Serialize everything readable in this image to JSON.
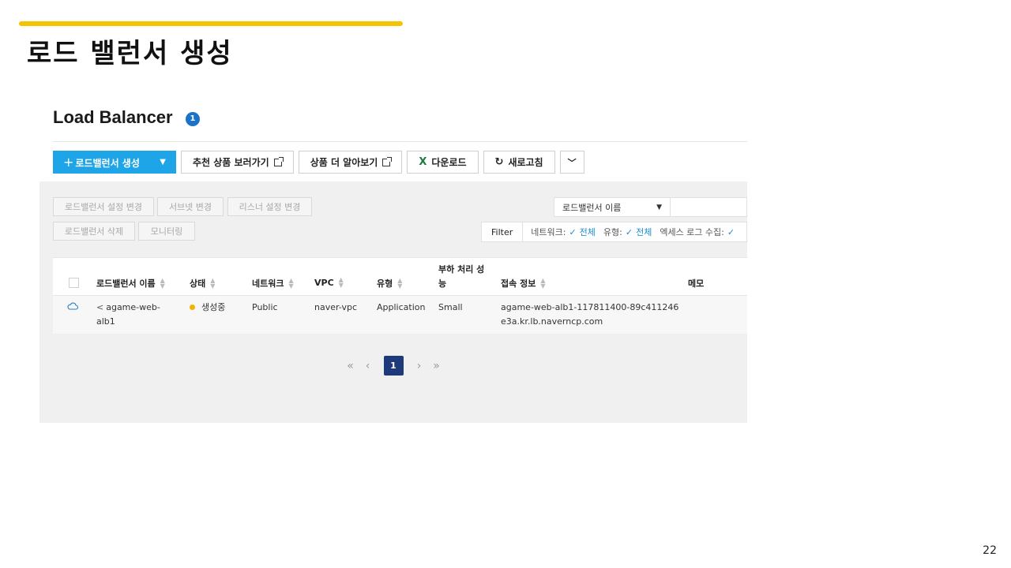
{
  "slide": {
    "title": "로드 밸런서 생성",
    "page_number": "22",
    "accent_color": "#f5c400"
  },
  "console": {
    "title": "Load Balancer",
    "count": "1",
    "toolbar": {
      "create_label": "로드밸런서 생성",
      "recommend_label": "추천 상품 보러가기",
      "learn_more_label": "상품 더 알아보기",
      "download_label": "다운로드",
      "refresh_label": "새로고침",
      "primary_color": "#1ea5e8"
    },
    "actions": {
      "change_settings": "로드밸런서 설정 변경",
      "change_subnet": "서브넷 변경",
      "change_listener": "리스너 설정 변경",
      "delete": "로드밸런서 삭제",
      "monitoring": "모니터링"
    },
    "search": {
      "selected_field": "로드밸런서 이름",
      "value": ""
    },
    "filter": {
      "label": "Filter",
      "items": [
        {
          "key": "네트워크:",
          "value": "전체"
        },
        {
          "key": "유형:",
          "value": "전체"
        },
        {
          "key": "엑세스 로그 수집:",
          "value": ""
        }
      ]
    },
    "table": {
      "headers": {
        "name": "로드밸런서 이름",
        "status": "상태",
        "network": "네트워크",
        "vpc": "VPC",
        "type": "유형",
        "performance_line1": "부하 처리 성",
        "performance_line2": "능",
        "endpoint": "접속 정보",
        "memo": "메모"
      },
      "rows": [
        {
          "name_line1": "agame-web-",
          "name_line2": "alb1",
          "status": "생성중",
          "status_color": "#f0b400",
          "network": "Public",
          "vpc": "naver-vpc",
          "type": "Application",
          "performance": "Small",
          "endpoint_line1": "agame-web-alb1-117811400-89c411246",
          "endpoint_line2": "e3a.kr.lb.naverncp.com",
          "memo": ""
        }
      ]
    },
    "pagination": {
      "current": "1"
    }
  }
}
